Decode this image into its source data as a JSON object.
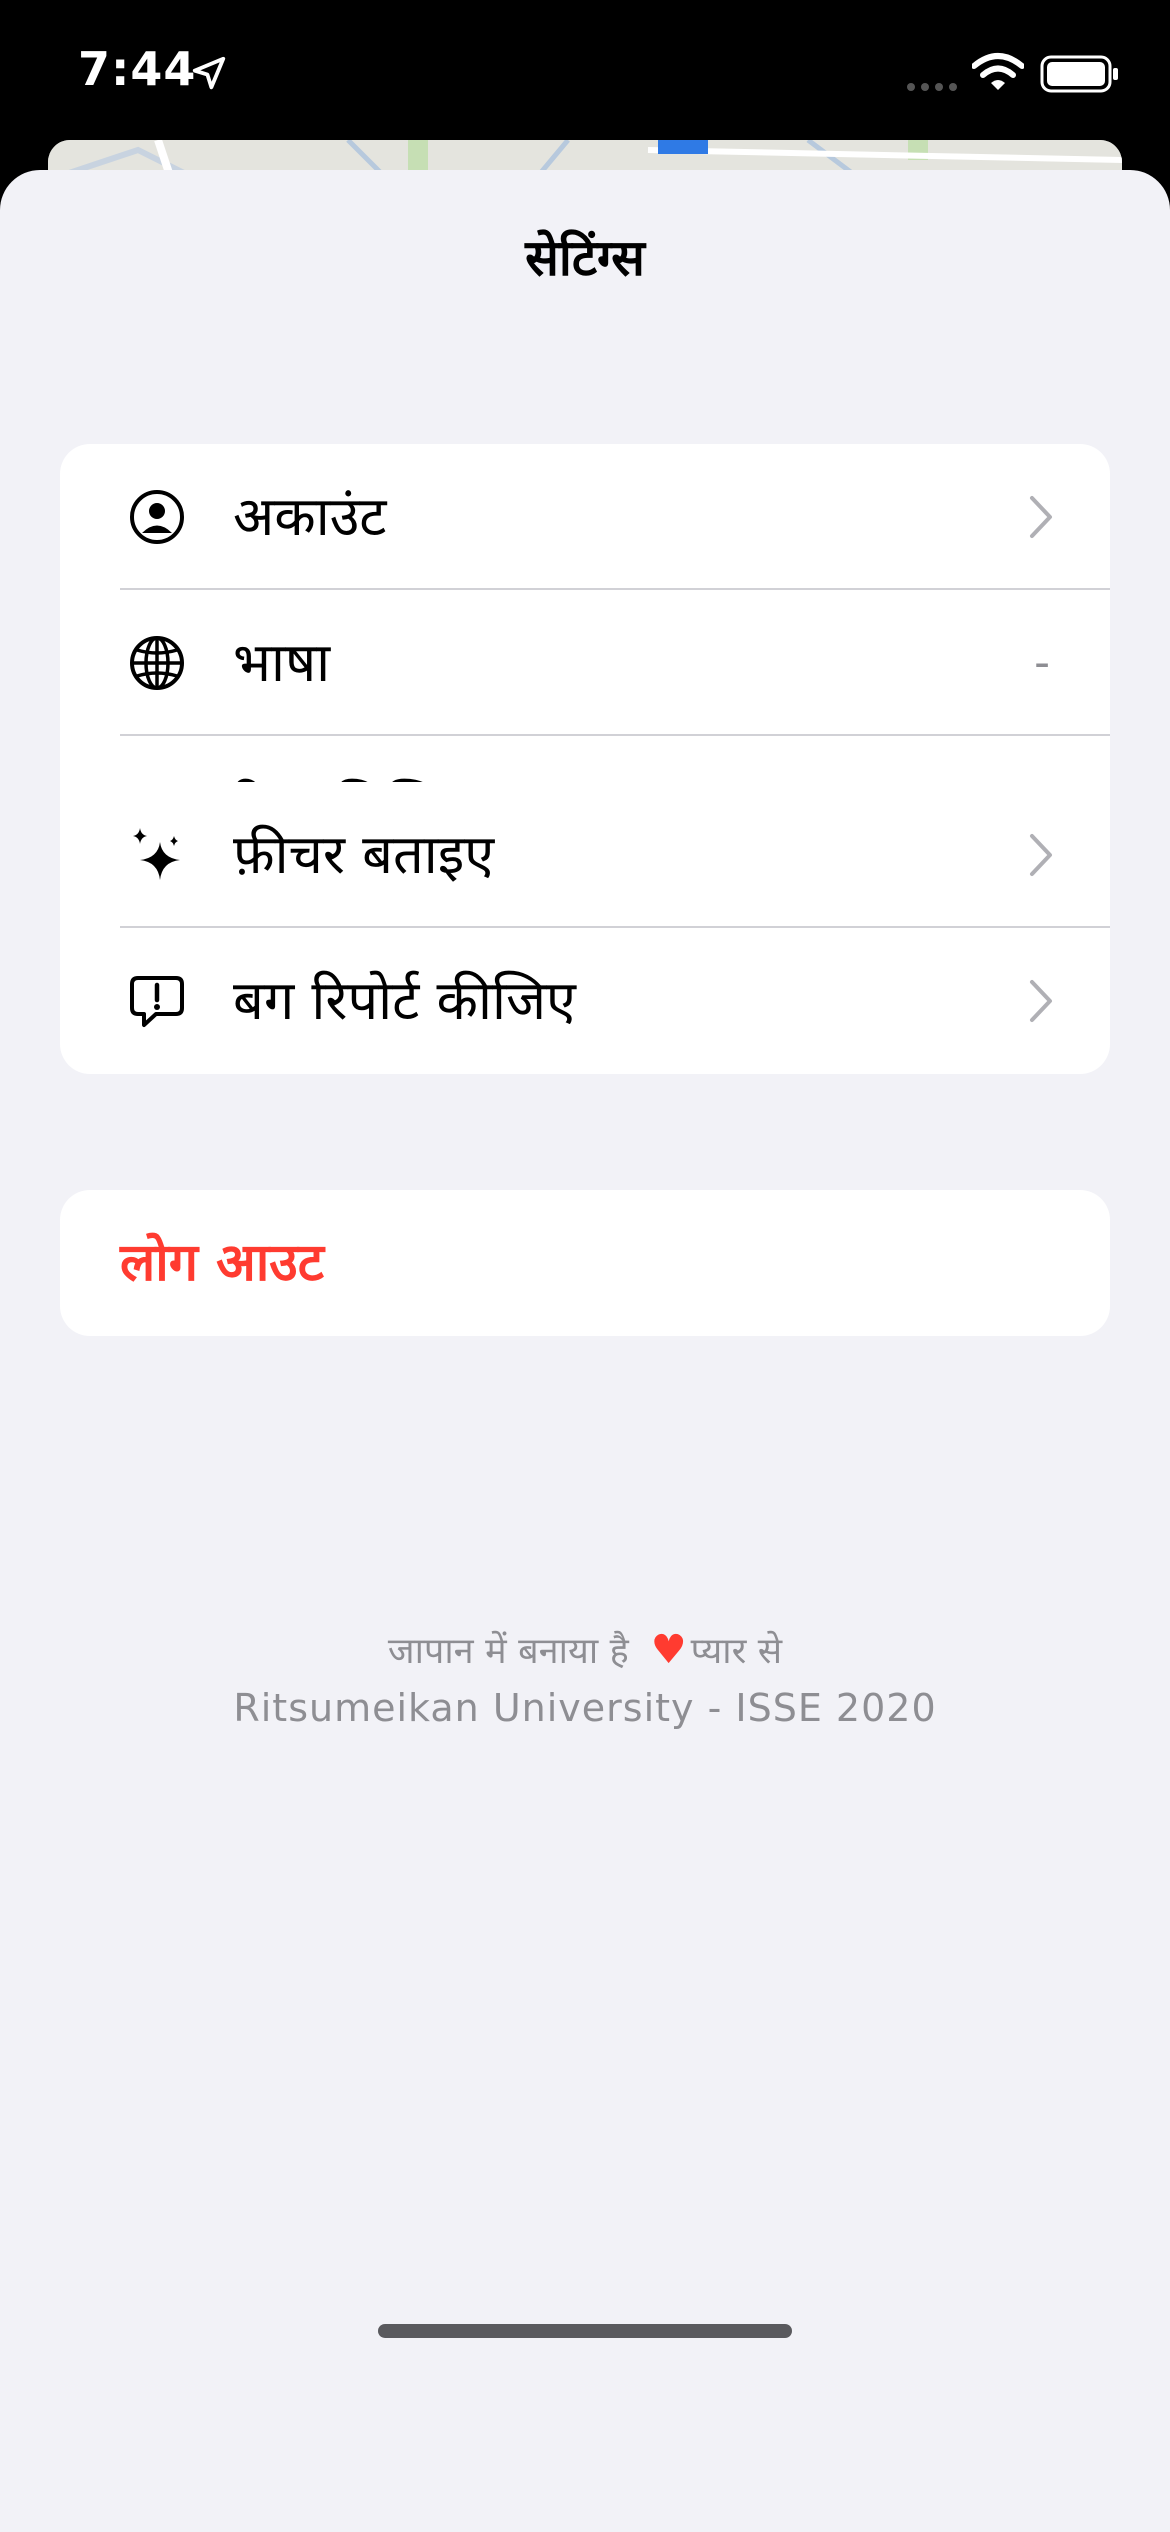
{
  "status_bar": {
    "time": "7:44"
  },
  "sheet": {
    "title": "सेटिंग्स"
  },
  "groups": [
    {
      "items": [
        {
          "label": "अकाउंट",
          "icon": "person-circle-icon",
          "accessory": "chevron"
        },
        {
          "label": "भाषा",
          "icon": "globe-icon",
          "value": "-"
        },
        {
          "label": "रिव्यू लिखिए",
          "icon": "review-card-icon",
          "accessory": "chevron"
        }
      ]
    },
    {
      "items": [
        {
          "label": "फ़ीचर बताइए",
          "icon": "sparkles-icon",
          "accessory": "chevron"
        },
        {
          "label": "बग रिपोर्ट कीजिए",
          "icon": "exclamation-bubble-icon",
          "accessory": "chevron"
        }
      ]
    }
  ],
  "logout": {
    "label": "लोग आउट",
    "color": "#ff3b30"
  },
  "footer": {
    "line1_prefix": "जापान में बनाया है",
    "heart": "♥",
    "line1_suffix": "प्यार से",
    "line2": "Ritsumeikan University - ISSE 2020"
  },
  "colors": {
    "background": "#f2f2f7",
    "card": "#ffffff",
    "secondary_text": "#8e8e93",
    "destructive": "#ff3b30"
  }
}
